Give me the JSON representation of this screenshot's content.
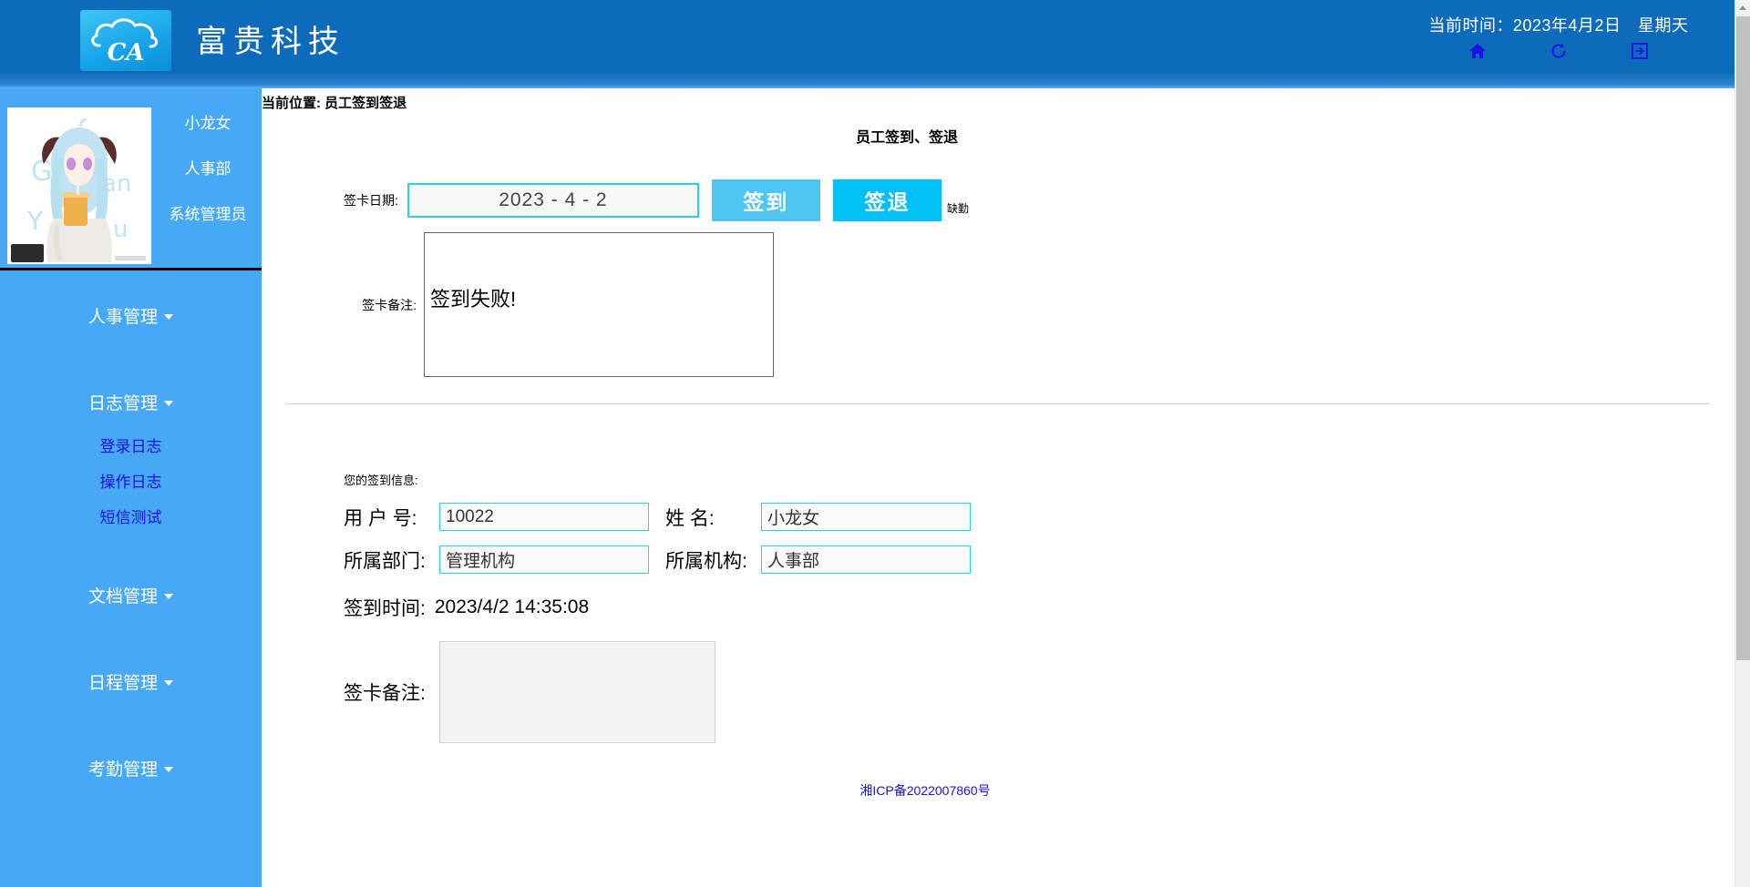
{
  "header": {
    "brand": "富贵科技",
    "logo_text": "CA",
    "current_time": "当前时间：2023年4月2日　星期天",
    "icons": [
      {
        "name": "home-icon",
        "label": "首页"
      },
      {
        "name": "refresh-icon",
        "label": "刷新"
      },
      {
        "name": "logout-icon",
        "label": "退出"
      }
    ]
  },
  "sidebar": {
    "profile": {
      "name": "小龙女",
      "department": "人事部",
      "role": "系统管理员"
    },
    "menu": [
      {
        "label": "人事管理",
        "children": []
      },
      {
        "label": "日志管理",
        "children": [
          {
            "label": "登录日志"
          },
          {
            "label": "操作日志"
          },
          {
            "label": "短信测试"
          }
        ]
      },
      {
        "label": "文档管理",
        "children": []
      },
      {
        "label": "日程管理",
        "children": []
      },
      {
        "label": "考勤管理",
        "children": []
      }
    ]
  },
  "breadcrumb": "当前位置: 员工签到签退",
  "main": {
    "page_title": "员工签到、签退",
    "sign_form": {
      "date_label": "签卡日期:",
      "date_value": "2023 - 4 - 2",
      "sign_in_button": "签到",
      "sign_out_button": "签退",
      "absent_label": "缺勤",
      "remark_label": "签卡备注:",
      "remark_value": "签到失败!"
    },
    "info": {
      "heading": "您的签到信息:",
      "user_id_label": "用 户 号:",
      "user_id_value": "10022",
      "name_label": "姓 名:",
      "name_value": "小龙女",
      "department_label": "所属部门:",
      "department_value": "管理机构",
      "org_label": "所属机构:",
      "org_value": "人事部",
      "sign_time_label": "签到时间:",
      "sign_time_value": "2023/4/2 14:35:08",
      "remark_label": "签卡备注:",
      "remark_value": ""
    }
  },
  "footer": {
    "icp": "湘ICP备2022007860号"
  },
  "colors": {
    "header_blue": "#0d6cbd",
    "sidebar_blue": "#47a8f5",
    "accent_cyan": "#21d6de",
    "btn_in": "#4ec6f2",
    "btn_out": "#00c0f5",
    "link_blue": "#1a10e8"
  }
}
